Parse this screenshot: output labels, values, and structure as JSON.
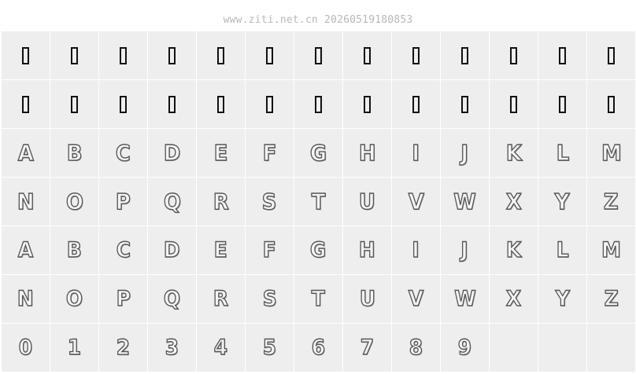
{
  "header": {
    "watermark": "www.ziti.net.cn 20260519180853"
  },
  "sample_rows": [
    {
      "name": "row-missing-1",
      "style": "tofu",
      "glyphs": [
        "",
        "",
        "",
        "",
        "",
        "",
        "",
        "",
        "",
        "",
        "",
        "",
        ""
      ]
    },
    {
      "name": "row-missing-2",
      "style": "tofu",
      "glyphs": [
        "",
        "",
        "",
        "",
        "",
        "",
        "",
        "",
        "",
        "",
        "",
        "",
        ""
      ]
    },
    {
      "name": "row-upper-a-m",
      "style": "dotted",
      "glyphs": [
        "A",
        "B",
        "C",
        "D",
        "E",
        "F",
        "G",
        "H",
        "I",
        "J",
        "K",
        "L",
        "M"
      ]
    },
    {
      "name": "row-upper-n-z",
      "style": "dotted",
      "glyphs": [
        "N",
        "O",
        "P",
        "Q",
        "R",
        "S",
        "T",
        "U",
        "V",
        "W",
        "X",
        "Y",
        "Z"
      ]
    },
    {
      "name": "row-lower-a-m",
      "style": "rounded",
      "glyphs": [
        "A",
        "B",
        "C",
        "D",
        "E",
        "F",
        "G",
        "H",
        "I",
        "J",
        "K",
        "L",
        "M"
      ]
    },
    {
      "name": "row-lower-n-z",
      "style": "rounded",
      "glyphs": [
        "N",
        "O",
        "P",
        "Q",
        "R",
        "S",
        "T",
        "U",
        "V",
        "W",
        "X",
        "Y",
        "Z"
      ]
    },
    {
      "name": "row-digits",
      "style": "rounded",
      "glyphs": [
        "0",
        "1",
        "2",
        "3",
        "4",
        "5",
        "6",
        "7",
        "8",
        "9",
        "",
        "",
        ""
      ]
    }
  ]
}
